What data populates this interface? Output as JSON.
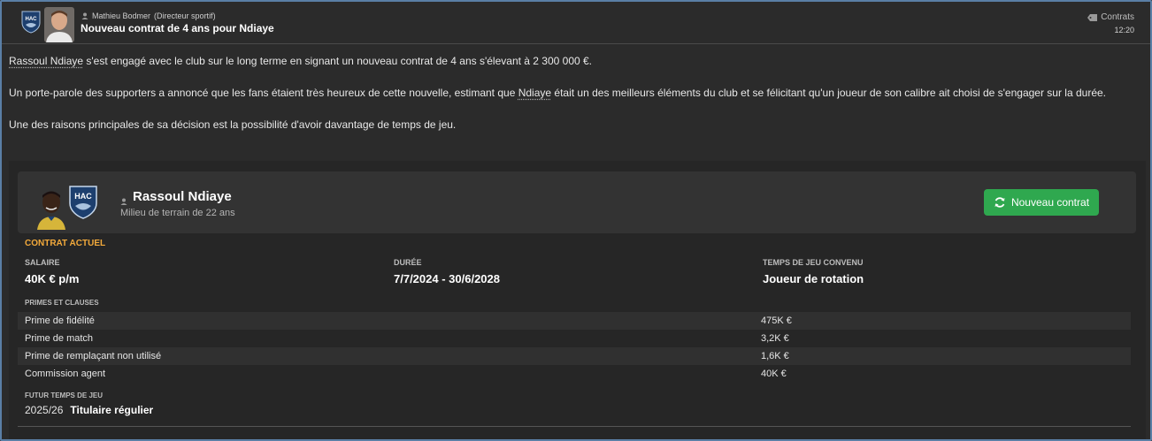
{
  "header": {
    "sender_name": "Mathieu Bodmer",
    "sender_role": "(Directeur sportif)",
    "subject": "Nouveau contrat de 4 ans pour Ndiaye",
    "category": "Contrats",
    "time": "12:20",
    "badge_text": "HAC"
  },
  "body": {
    "p1_name": "Rassoul Ndiaye",
    "p1_text": " s'est engagé avec le club sur le long terme en signant un nouveau contrat de 4 ans s'élevant à 2 300 000 €.",
    "p2_pre": "Un porte-parole des supporters a annoncé que les fans étaient très heureux de cette nouvelle, estimant que ",
    "p2_name": "Ndiaye",
    "p2_post": " était un des meilleurs éléments du club et se félicitant qu'un joueur de son calibre ait choisi de s'engager sur la durée.",
    "p3": "Une des raisons principales de sa décision est la possibilité d'avoir davantage de temps de jeu."
  },
  "player": {
    "name": "Rassoul Ndiaye",
    "subtitle": "Milieu de terrain de 22 ans",
    "badge_text": "HAC",
    "button_label": "Nouveau contrat"
  },
  "contract": {
    "section_title": "CONTRAT ACTUEL",
    "salary_label": "SALAIRE",
    "salary_value": "40K € p/m",
    "duration_label": "DURÉE",
    "duration_value": "7/7/2024 - 30/6/2028",
    "playtime_label": "TEMPS DE JEU CONVENU",
    "playtime_value": "Joueur de rotation",
    "clauses_label": "PRIMES ET CLAUSES",
    "clauses": [
      {
        "name": "Prime de fidélité",
        "value": "475K €"
      },
      {
        "name": "Prime de match",
        "value": "3,2K €"
      },
      {
        "name": "Prime de remplaçant non utilisé",
        "value": "1,6K €"
      },
      {
        "name": "Commission agent",
        "value": "40K €"
      }
    ],
    "future_label": "FUTUR TEMPS DE JEU",
    "future_season": "2025/26",
    "future_role": "Titulaire régulier"
  },
  "colors": {
    "accent_orange": "#f2a93b",
    "button_green": "#2fa84f",
    "frame_blue": "#5a7fa6",
    "background": "#2b2b2b"
  }
}
